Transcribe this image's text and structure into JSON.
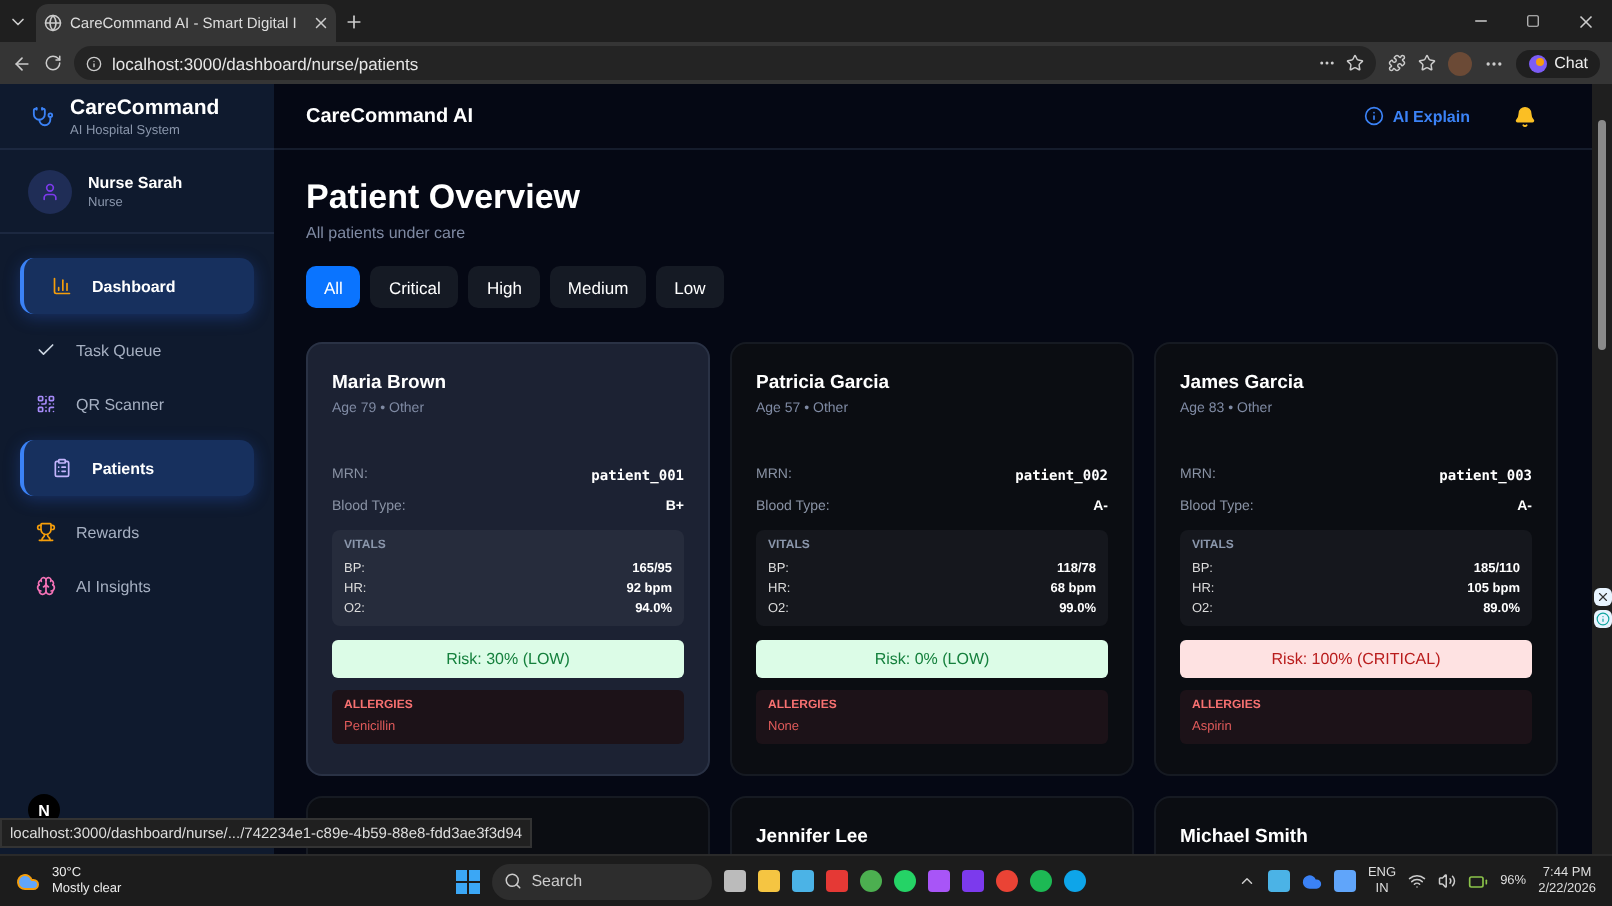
{
  "browser": {
    "tab_title": "CareCommand AI - Smart Digital I",
    "url": "localhost:3000/dashboard/nurse/patients",
    "chat_label": "Chat"
  },
  "sidebar": {
    "brand": "CareCommand",
    "tagline": "AI Hospital System",
    "user": {
      "name": "Nurse Sarah",
      "role": "Nurse"
    },
    "items": [
      {
        "label": "Dashboard",
        "selected": true
      },
      {
        "label": "Task Queue",
        "selected": false
      },
      {
        "label": "QR Scanner",
        "selected": false
      },
      {
        "label": "Patients",
        "selected": true
      },
      {
        "label": "Rewards",
        "selected": false
      },
      {
        "label": "AI Insights",
        "selected": false
      }
    ]
  },
  "header": {
    "title": "CareCommand AI",
    "explain": "AI Explain"
  },
  "page": {
    "title": "Patient Overview",
    "subtitle": "All patients under care"
  },
  "filters": [
    {
      "label": "All",
      "selected": true
    },
    {
      "label": "Critical",
      "selected": false
    },
    {
      "label": "High",
      "selected": false
    },
    {
      "label": "Medium",
      "selected": false
    },
    {
      "label": "Low",
      "selected": false
    }
  ],
  "patients": [
    {
      "name": "Maria Brown",
      "meta": "Age 79 • Other",
      "hovered": true,
      "mrn_label": "MRN:",
      "mrn": "patient_001",
      "blood_label": "Blood Type:",
      "blood": "B+",
      "vitals_label": "VITALS",
      "vitals": [
        {
          "label": "BP:",
          "value": "165/95"
        },
        {
          "label": "HR:",
          "value": "92 bpm"
        },
        {
          "label": "O2:",
          "value": "94.0%"
        }
      ],
      "risk": "Risk: 30% (LOW)",
      "kind": "low",
      "allergies_label": "ALLERGIES",
      "allergies": "Penicillin"
    },
    {
      "name": "Patricia Garcia",
      "meta": "Age 57 • Other",
      "hovered": false,
      "mrn_label": "MRN:",
      "mrn": "patient_002",
      "blood_label": "Blood Type:",
      "blood": "A-",
      "vitals_label": "VITALS",
      "vitals": [
        {
          "label": "BP:",
          "value": "118/78"
        },
        {
          "label": "HR:",
          "value": "68 bpm"
        },
        {
          "label": "O2:",
          "value": "99.0%"
        }
      ],
      "risk": "Risk: 0% (LOW)",
      "kind": "low",
      "allergies_label": "ALLERGIES",
      "allergies": "None"
    },
    {
      "name": "James Garcia",
      "meta": "Age 83 • Other",
      "hovered": false,
      "mrn_label": "MRN:",
      "mrn": "patient_003",
      "blood_label": "Blood Type:",
      "blood": "A-",
      "vitals_label": "VITALS",
      "vitals": [
        {
          "label": "BP:",
          "value": "185/110"
        },
        {
          "label": "HR:",
          "value": "105 bpm"
        },
        {
          "label": "O2:",
          "value": "89.0%"
        }
      ],
      "risk": "Risk: 100% (CRITICAL)",
      "kind": "critical",
      "allergies_label": "ALLERGIES",
      "allergies": "Aspirin"
    },
    {
      "hovered": false
    },
    {
      "name": "Jennifer Lee",
      "hovered": false
    },
    {
      "name": "Michael Smith",
      "hovered": false
    }
  ],
  "status_url": "localhost:3000/dashboard/nurse/.../742234e1-c89e-4b59-88e8-fdd3ae3f3d94",
  "dev_badge": "N",
  "taskbar": {
    "temp": "30°C",
    "weather": "Mostly clear",
    "search": "Search",
    "lang": "ENG",
    "region": "IN",
    "battery": "96%",
    "time": "7:44 PM",
    "date": "2/22/2026"
  }
}
